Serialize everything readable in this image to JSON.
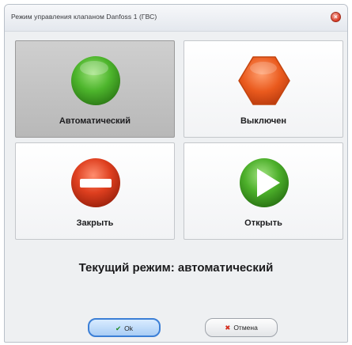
{
  "window": {
    "title": "Режим управления клапаном Danfoss 1 (ГВС)",
    "close_glyph": "×"
  },
  "modes": {
    "auto": {
      "label": "Автоматический",
      "icon": "green-circle-icon",
      "selected": true
    },
    "off": {
      "label": "Выключен",
      "icon": "orange-hexagon-icon",
      "selected": false
    },
    "close": {
      "label": "Закрыть",
      "icon": "red-minus-icon",
      "selected": false
    },
    "open": {
      "label": "Открыть",
      "icon": "green-play-icon",
      "selected": false
    }
  },
  "status": {
    "text": "Текущий режим: автоматический"
  },
  "buttons": {
    "ok": {
      "label": "Ok",
      "glyph": "✔"
    },
    "cancel": {
      "label": "Отмена",
      "glyph": "✖"
    }
  },
  "colors": {
    "selected_tile": "#bfbfbf",
    "green": "#4caf2a",
    "orange": "#e8521c",
    "red": "#d93b1e"
  }
}
